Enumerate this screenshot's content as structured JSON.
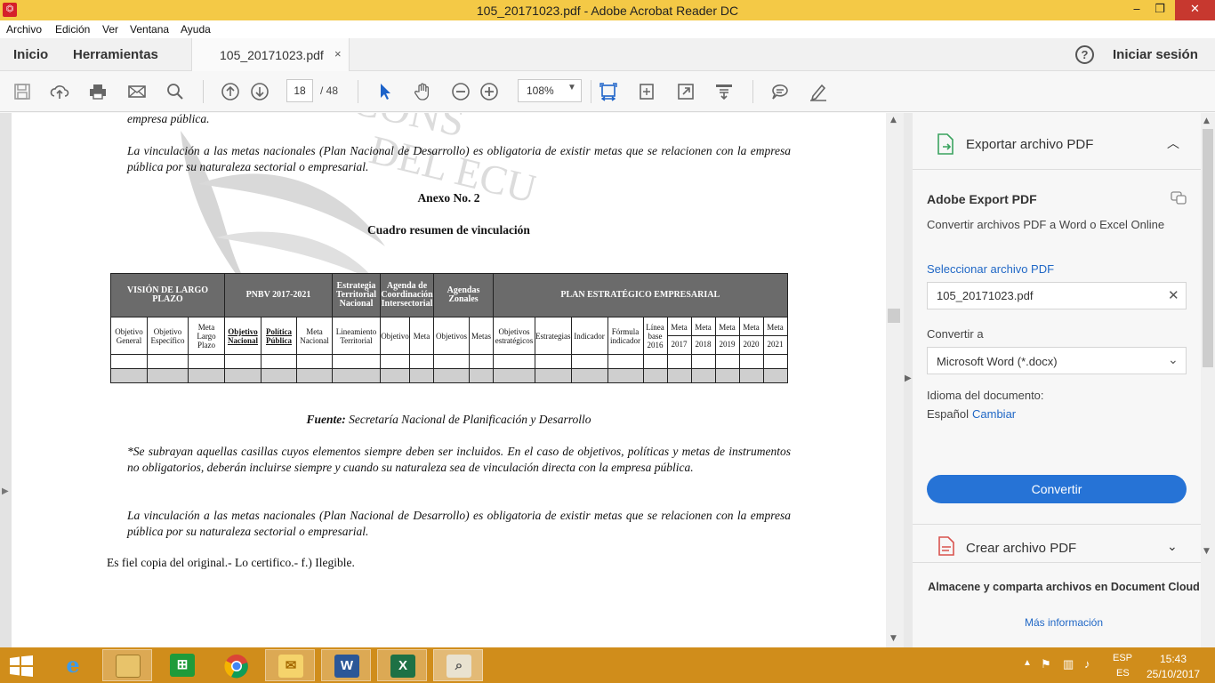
{
  "window": {
    "title": "105_20171023.pdf - Adobe Acrobat Reader DC",
    "minimize": "‒",
    "restore": "❐",
    "close": "✕"
  },
  "menu": [
    "Archivo",
    "Edición",
    "Ver",
    "Ventana",
    "Ayuda"
  ],
  "tabs": {
    "home": "Inicio",
    "tools": "Herramientas",
    "document": "105_20171023.pdf",
    "doc_close": "×",
    "help": "?",
    "signin": "Iniciar sesión"
  },
  "toolbar": {
    "current_page": "18",
    "total_pages": "/ 48",
    "zoom": "108%",
    "zoom_arrow": "▼",
    "icons": [
      "save-icon",
      "upload-icon",
      "print-icon",
      "email-icon",
      "search-icon",
      "page-up-icon",
      "page-down-icon",
      "select-cursor-icon",
      "hand-icon",
      "zoom-out-icon",
      "zoom-in-icon",
      "fit-page-icon",
      "rotate-icon",
      "fullscreen-icon",
      "scroll-mode-icon",
      "comment-icon",
      "highlight-pen-icon"
    ]
  },
  "document": {
    "top_fragment": "empresa pública.",
    "para_vinc_1": "La vinculación a las metas nacionales (Plan Nacional de Desarrollo) es obligatoria de existir metas que se relacionen con la empresa pública por su naturaleza sectorial o empresarial.",
    "annex_title": "Anexo No. 2",
    "table_title": "Cuadro resumen de vinculación",
    "table": {
      "groups": [
        "VISIÓN DE LARGO PLAZO",
        "PNBV 2017-2021",
        "Estrategia Territorial Nacional",
        "Agenda de Coordinación Intersectorial",
        "Agendas Zonales",
        "PLAN ESTRATÉGICO EMPRESARIAL"
      ],
      "columns": [
        "Objetivo General",
        "Objetivo Específico",
        "Meta Largo Plazo",
        "Objetivo Nacional",
        "Política Pública",
        "Meta Nacional",
        "Lineamiento Territorial",
        "Objetivo",
        "Meta",
        "Objetivos",
        "Metas",
        "Objetivos estratégicos",
        "Estrategias",
        "Indicador",
        "Fórmula indicador",
        "Línea base 2016",
        "Meta",
        "Meta",
        "Meta",
        "Meta",
        "Meta"
      ],
      "years": [
        "2017",
        "2018",
        "2019",
        "2020",
        "2021"
      ]
    },
    "source_label": "Fuente:",
    "source_text": "Secretaría Nacional de Planificación y Desarrollo",
    "note": "*Se subrayan aquellas casillas cuyos elementos siempre deben ser incluidos. En el caso de objetivos, políticas y metas de instrumentos no obligatorios, deberán incluirse siempre y cuando su naturaleza sea de vinculación directa con la empresa pública.",
    "para_vinc_2": "La vinculación a las metas nacionales (Plan Nacional de Desarrollo) es obligatoria de existir metas que se relacionen con la empresa pública por su naturaleza sectorial o empresarial.",
    "certify": "Es fiel copia del original.- Lo certifico.- f.) Ilegible."
  },
  "right_panel": {
    "export_header": "Exportar archivo PDF",
    "export_chevron": "︿",
    "service_title": "Adobe Export PDF",
    "service_desc": "Convertir archivos PDF a Word o Excel Online",
    "select_file_label": "Seleccionar archivo PDF",
    "selected_file": "105_20171023.pdf",
    "clear_icon": "✕",
    "convert_to_label": "Convertir a",
    "convert_to_value": "Microsoft Word (*.docx)",
    "select_arrow": "⌄",
    "language_label": "Idioma del documento:",
    "language_value": "Español",
    "change_link": "Cambiar",
    "convert_button": "Convertir",
    "create_header": "Crear archivo PDF",
    "create_chevron": "⌄",
    "cloud_text": "Almacene y comparta archivos en Document Cloud",
    "more_info": "Más información"
  },
  "taskbar": {
    "apps": [
      "internet-explorer",
      "file-explorer",
      "store",
      "chrome",
      "outlook",
      "word",
      "excel",
      "acrobat-reader"
    ],
    "lang_top": "ESP",
    "lang_bottom": "ES",
    "time": "15:43",
    "date": "25/10/2017"
  },
  "colors": {
    "titlebar": "#f4c946",
    "taskbar": "#d08d1b",
    "accent_blue": "#2673d6",
    "table_header": "#6b6b6b"
  }
}
